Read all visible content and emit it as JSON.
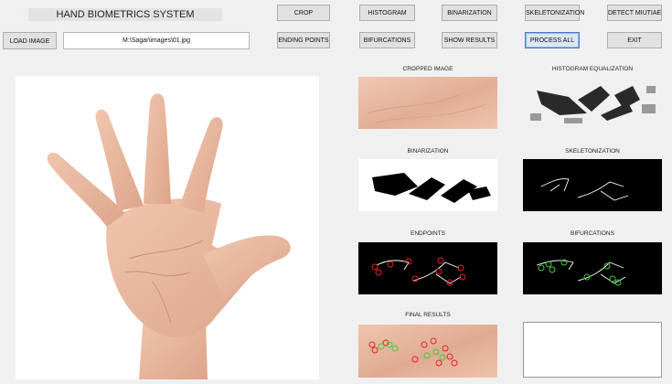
{
  "app": {
    "title": "HAND BIOMETRICS SYSTEM"
  },
  "toolbar": {
    "load_image": "LOAD IMAGE",
    "image_path": "M:\\Sagar\\images\\01.jpg",
    "crop": "CROP",
    "histogram": "HISTOGRAM",
    "binarization": "BINARIZATION",
    "skeletonization": "SKELETONIZATION",
    "detect_minutiae": "DETECT MIUTIAE",
    "ending_points": "ENDING POINTS",
    "bifurcations": "BIFURCATIONS",
    "show_results": "SHOW RESULTS",
    "process_all": "PROCESS ALL",
    "exit": "EXIT"
  },
  "panels": {
    "cropped": "CROPPED IMAGE",
    "histogram_eq": "HISTOGRAM EQUALIZATION",
    "binarization": "BINARIZATION",
    "skeletonization": "SKELETONIZATION",
    "endpoints": "ENDPOINTS",
    "bifurcations": "BIFURCATIONS",
    "final": "FINAL RESULTS"
  },
  "colors": {
    "skin": "#e8b9a1",
    "endpoint_marker": "#e52222",
    "bifurcation_marker": "#3ecf3e"
  },
  "images": {
    "main": "hand-photo",
    "histogram": "equalized-texture",
    "final": "palm-crop-with-minutiae"
  }
}
